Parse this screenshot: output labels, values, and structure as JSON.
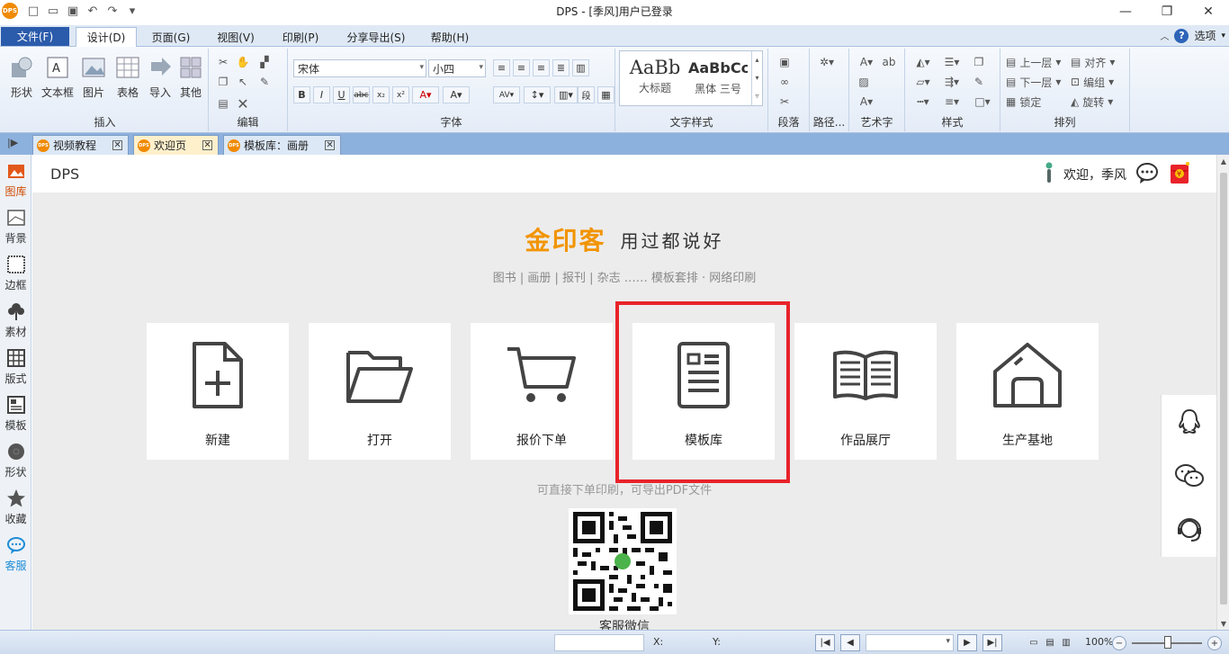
{
  "window": {
    "title": "DPS - [季风]用户已登录",
    "app_icon": "DPS"
  },
  "menu": {
    "file": "文件(F)",
    "tabs": [
      "设计(D)",
      "页面(G)",
      "视图(V)",
      "印刷(P)",
      "分享导出(S)",
      "帮助(H)"
    ],
    "options": "选项"
  },
  "ribbon": {
    "insert": {
      "label": "插入",
      "buttons": [
        "形状",
        "文本框",
        "图片",
        "表格",
        "导入",
        "其他"
      ]
    },
    "edit": {
      "label": "编辑"
    },
    "font": {
      "label": "字体",
      "font_name": "宋体",
      "font_size": "小四"
    },
    "text_style": {
      "label": "文字样式",
      "styles": [
        {
          "sample": "AaBb",
          "name": "大标题"
        },
        {
          "sample": "AaBbCc",
          "name": "黑体  三号"
        }
      ]
    },
    "paragraph": {
      "label": "段落"
    },
    "path": {
      "label": "路径..."
    },
    "art": {
      "label": "艺术字"
    },
    "style": {
      "label": "样式"
    },
    "arrange": {
      "label": "排列",
      "items": [
        "上一层",
        "下一层",
        "锁定",
        "对齐",
        "编组",
        "旋转"
      ]
    }
  },
  "doc_tabs": [
    {
      "label": "视频教程",
      "active": false
    },
    {
      "label": "欢迎页",
      "active": true
    },
    {
      "label": "模板库：画册",
      "active": false
    }
  ],
  "sidebar": {
    "items": [
      "图库",
      "背景",
      "边框",
      "素材",
      "版式",
      "模板",
      "形状",
      "收藏",
      "客服"
    ]
  },
  "content": {
    "header": {
      "title": "DPS",
      "welcome": "欢迎，季风"
    },
    "brand": "金印客",
    "slogan": "用过都说好",
    "subslogan": "图书 | 画册 | 报刊 | 杂志 …… 模板套排 · 网络印刷",
    "cards": [
      "新建",
      "打开",
      "报价下单",
      "模板库",
      "作品展厅",
      "生产基地"
    ],
    "tip": "可直接下单印刷，可导出PDF文件",
    "qr_label": "客服微信"
  },
  "statusbar": {
    "x_label": "X:",
    "y_label": "Y:",
    "zoom": "100%"
  },
  "colors": {
    "accent": "#f29400",
    "highlight": "#e8232a",
    "file_tab": "#2b5bab"
  }
}
